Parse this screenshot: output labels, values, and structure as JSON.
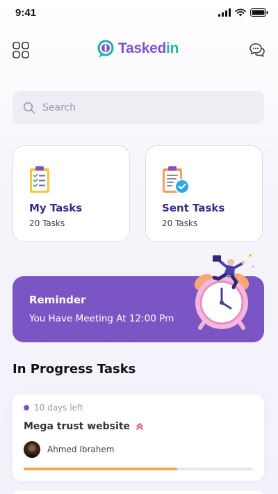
{
  "status_bar": {
    "time": "9:41"
  },
  "header": {
    "logo_part1": "Tasked",
    "logo_part2": "in"
  },
  "search": {
    "placeholder": "Search",
    "value": ""
  },
  "cards": [
    {
      "title": "My Tasks",
      "subtitle": "20 Tasks",
      "icon": "clipboard-checklist-icon"
    },
    {
      "title": "Sent Tasks",
      "subtitle": "20 Tasks",
      "icon": "clipboard-sent-icon"
    }
  ],
  "reminder": {
    "title": "Reminder",
    "text": "You Have Meeting At 12:00 Pm"
  },
  "in_progress": {
    "title": "In Progress Tasks",
    "tasks": [
      {
        "due": "10 days left",
        "name": "Mega trust website",
        "priority_icon": "double-chevron-up-icon",
        "assignee": "Ahmed Ibrahem",
        "progress": 0.67
      }
    ]
  },
  "colors": {
    "primary": "#7b55c4",
    "teal": "#27b1a8",
    "card_title": "#3a2a8c",
    "progress": "#f7a650",
    "priority": "#e0455a"
  }
}
